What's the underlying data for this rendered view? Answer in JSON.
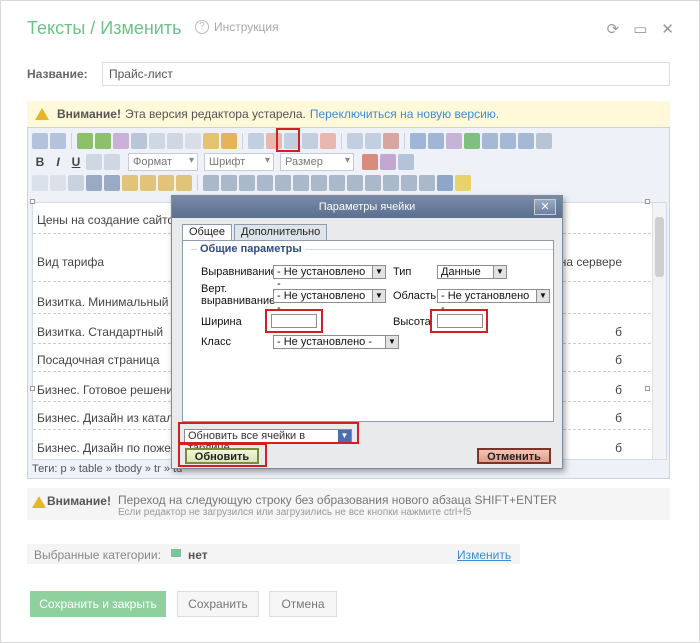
{
  "header": {
    "title": "Тексты / Изменить",
    "help_label": "Инструкция"
  },
  "name_field": {
    "label": "Название:",
    "value": "Прайс-лист"
  },
  "warning": {
    "bold": "Внимание!",
    "text": "Эта версия редактора устарела.",
    "link": "Переключиться на новую версию."
  },
  "toolbar": {
    "format_select": "Формат",
    "font_select": "Шрифт",
    "size_select": "Размер",
    "bold_label": "B",
    "italic_label": "I",
    "underline_label": "U"
  },
  "content": {
    "rows": [
      "Цены на создание сайтов",
      "Вид тарифа",
      "Визитка. Минимальный",
      "Визитка. Стандартный",
      "Посадочная страница",
      "Бизнес. Готовое решение",
      "Бизнес. Дизайн из каталог",
      "Бизнес. Дизайн по пожел"
    ],
    "right_header": "на сервере",
    "right_suffix": "б",
    "status_path": "Теги: p » table » tbody » tr » td"
  },
  "dialog": {
    "title": "Параметры ячейки",
    "close_label": "✕",
    "tabs": [
      "Общее",
      "Дополнительно"
    ],
    "legend": "Общие параметры",
    "align_label": "Выравнивание",
    "align_value": "- Не установлено -",
    "type_label": "Тип",
    "type_value": "Данные",
    "valign_label_1": "Верт.",
    "valign_label_2": "выравнивание",
    "valign_value": "- Не установлено -",
    "scope_label": "Область",
    "scope_value": "- Не установлено -",
    "width_label": "Ширина",
    "height_label": "Высота",
    "class_label": "Класс",
    "class_value": "- Не установлено -",
    "update_select": "Обновить все ячейки в таблице",
    "update_button": "Обновить",
    "cancel_button": "Отменить"
  },
  "hint": {
    "bold": "Внимание!",
    "line1": "Переход на следующую строку без образования нового абзаца SHIFT+ENTER",
    "line2": "Если редактор не загрузился или загрузились не все кнопки нажмите ctrl+f5"
  },
  "categories": {
    "label": "Выбранные категории:",
    "value": "нет",
    "change_link": "Изменить"
  },
  "buttons": {
    "save_close": "Сохранить и закрыть",
    "save": "Сохранить",
    "cancel": "Отмена"
  },
  "colors": {
    "accent_green": "#6cc287",
    "link_blue": "#3a8dd6",
    "highlight_red": "#d21f1f"
  }
}
